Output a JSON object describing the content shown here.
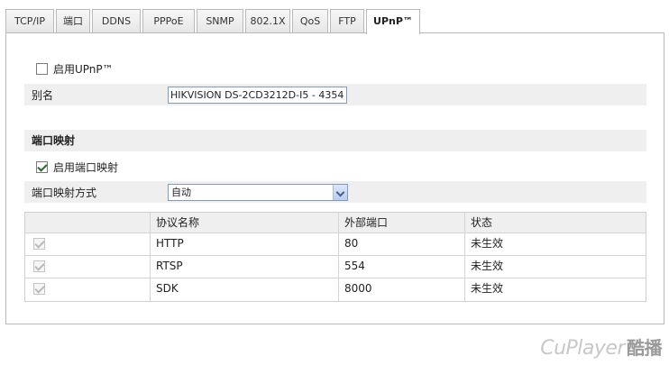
{
  "tabs": [
    {
      "label": "TCP/IP"
    },
    {
      "label": "端口"
    },
    {
      "label": "DDNS"
    },
    {
      "label": "PPPoE"
    },
    {
      "label": "SNMP"
    },
    {
      "label": "802.1X"
    },
    {
      "label": "QoS"
    },
    {
      "label": "FTP"
    },
    {
      "label": "UPnP™"
    }
  ],
  "upnp": {
    "enable_label": "启用UPnP™",
    "enable_checked": false,
    "alias_label": "别名",
    "alias_value": "HIKVISION DS-2CD3212D-I5 - 4354"
  },
  "port_mapping": {
    "section_title": "端口映射",
    "enable_label": "启用端口映射",
    "enable_checked": true,
    "mode_label": "端口映射方式",
    "mode_value": "自动",
    "table": {
      "headers": [
        "",
        "协议名称",
        "外部端口",
        "状态"
      ],
      "rows": [
        {
          "checked": true,
          "protocol": "HTTP",
          "port": "80",
          "status": "未生效"
        },
        {
          "checked": true,
          "protocol": "RTSP",
          "port": "554",
          "status": "未生效"
        },
        {
          "checked": true,
          "protocol": "SDK",
          "port": "8000",
          "status": "未生效"
        }
      ]
    }
  },
  "watermark": {
    "text": "CuPlayer",
    "cn": "酷播"
  }
}
